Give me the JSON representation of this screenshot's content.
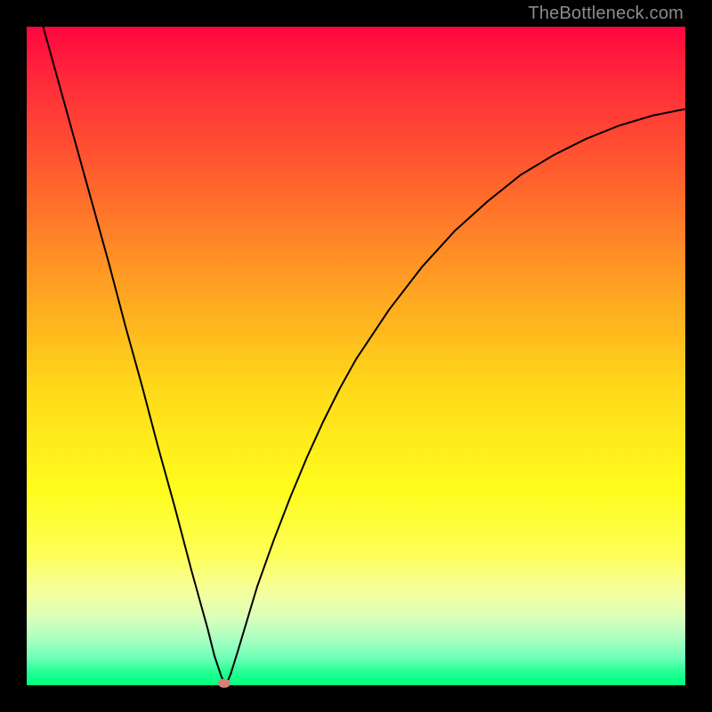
{
  "attribution": "TheBottleneck.com",
  "chart_data": {
    "type": "line",
    "title": "",
    "xlabel": "",
    "ylabel": "",
    "xlim": [
      0,
      100
    ],
    "ylim": [
      0,
      100
    ],
    "x": [
      0,
      2.5,
      5,
      7.5,
      10,
      12.5,
      15,
      17.5,
      20,
      22.5,
      25,
      27.5,
      28.5,
      29.5,
      30,
      30.5,
      31,
      32,
      33.5,
      35,
      37.5,
      40,
      42.5,
      45,
      47.5,
      50,
      55,
      60,
      65,
      70,
      75,
      80,
      85,
      90,
      95,
      100
    ],
    "values": [
      109,
      100,
      91,
      82,
      73,
      64,
      54.5,
      45.5,
      36,
      27,
      17.5,
      8.5,
      4.5,
      1.5,
      0.3,
      0.6,
      1.8,
      5,
      10,
      15,
      22,
      28.5,
      34.5,
      40,
      45,
      49.5,
      57,
      63.5,
      69,
      73.5,
      77.5,
      80.5,
      83,
      85,
      86.5,
      87.5
    ],
    "minimum_point": {
      "x": 30,
      "y": 0.3
    },
    "background_gradient": {
      "orientation": "vertical",
      "stops": [
        {
          "pos": 0.0,
          "color": "#ff063e"
        },
        {
          "pos": 0.2,
          "color": "#ff5530"
        },
        {
          "pos": 0.55,
          "color": "#ffd91a"
        },
        {
          "pos": 0.8,
          "color": "#feff56"
        },
        {
          "pos": 0.93,
          "color": "#a8ffc2"
        },
        {
          "pos": 1.0,
          "color": "#00ff7e"
        }
      ]
    }
  }
}
